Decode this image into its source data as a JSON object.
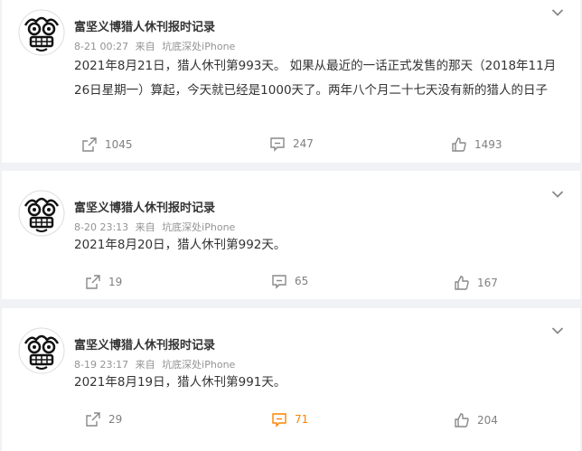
{
  "colors": {
    "accent": "#ff8200",
    "muted": "#808080",
    "text": "#333333",
    "background": "#f1f2f5"
  },
  "icons": {
    "avatar": "avatar-face",
    "more": "chevron-down-icon",
    "repost": "repost-icon",
    "comment": "comment-icon",
    "like": "like-icon"
  },
  "posts": [
    {
      "author": "富坚义博猎人休刊报时记录",
      "time": "8-21 00:27",
      "source_prefix": "来自",
      "source": "坑底深处iPhone",
      "text": "2021年8月21日，猎人休刊第993天。 如果从最近的一话正式发售的那天（2018年11月26日星期一）算起，今天就已经是1000天了。两年八个月二十七天没有新的猎人的日子",
      "reposts": "1045",
      "comments": "247",
      "likes": "1493"
    },
    {
      "author": "富坚义博猎人休刊报时记录",
      "time": "8-20 23:13",
      "source_prefix": "来自",
      "source": "坑底深处iPhone",
      "text": "2021年8月20日，猎人休刊第992天。",
      "reposts": "19",
      "comments": "65",
      "likes": "167"
    },
    {
      "author": "富坚义博猎人休刊报时记录",
      "time": "8-19 23:17",
      "source_prefix": "来自",
      "source": "坑底深处iPhone",
      "text": "2021年8月19日，猎人休刊第991天。",
      "reposts": "29",
      "comments": "71",
      "likes": "204"
    }
  ]
}
